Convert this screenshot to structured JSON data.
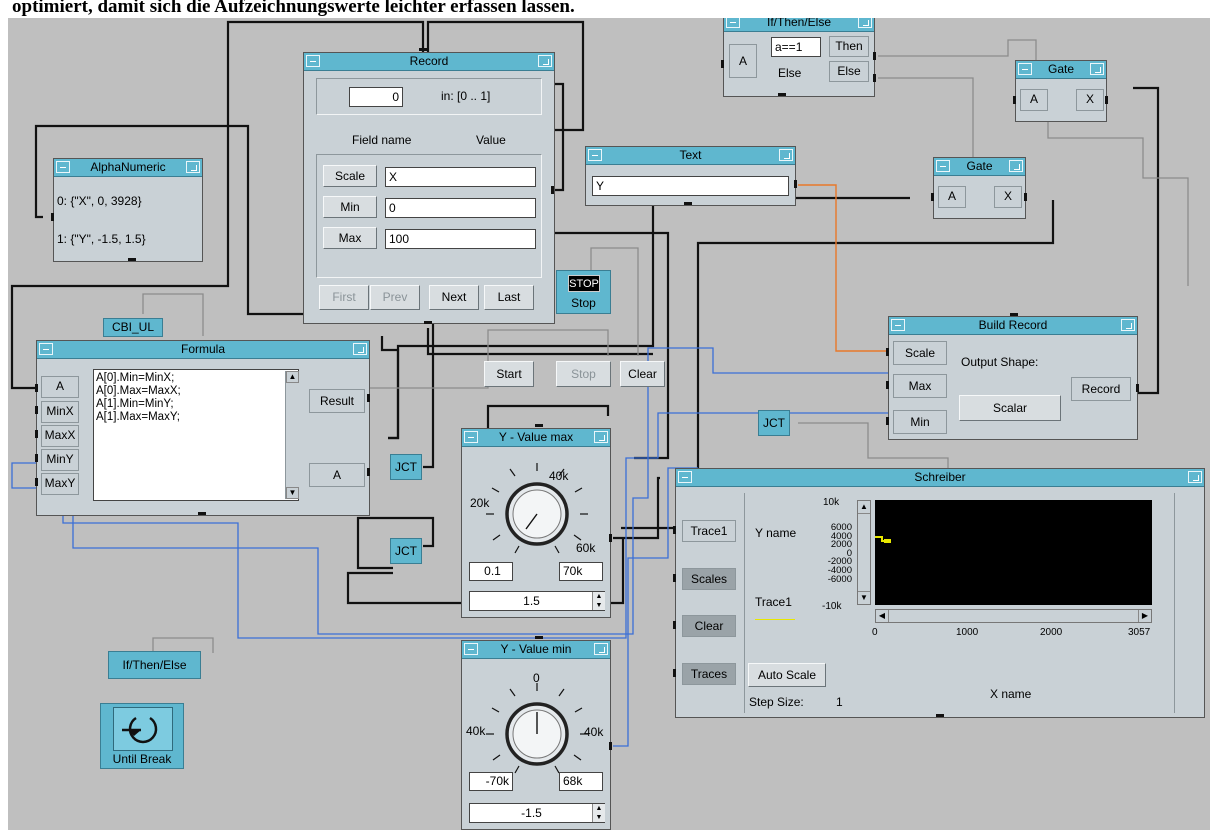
{
  "heading": "optimiert, damit sich die Aufzeichnungswerte leichter erfassen lassen.",
  "record": {
    "title": "Record",
    "index_value": "0",
    "range": "in: [0 .. 1]",
    "field_name_header": "Field name",
    "value_header": "Value",
    "fields": [
      {
        "name": "Scale",
        "value": "X"
      },
      {
        "name": "Min",
        "value": "0"
      },
      {
        "name": "Max",
        "value": "100"
      }
    ],
    "nav": [
      "First",
      "Prev",
      "Next",
      "Last"
    ]
  },
  "alphanumeric": {
    "title": "AlphaNumeric",
    "lines": [
      "0: {\"X\", 0, 3928}",
      "1: {\"Y\", -1.5, 1.5}"
    ]
  },
  "if_then_else_top": {
    "title": "If/Then/Else",
    "input": "A",
    "condition": "a==1",
    "else_label": "Else",
    "outputs": [
      "Then",
      "Else"
    ]
  },
  "gate_top": {
    "title": "Gate",
    "input": "A",
    "output": "X"
  },
  "gate_mid": {
    "title": "Gate",
    "input": "A",
    "output": "X"
  },
  "text_box": {
    "title": "Text",
    "value": "Y"
  },
  "stop_button": {
    "icon_text": "STOP",
    "label": "Stop"
  },
  "cbi_ul": "CBI_UL",
  "formula": {
    "title": "Formula",
    "inputs": [
      "A",
      "MinX",
      "MaxX",
      "MinY",
      "MaxY"
    ],
    "lines": [
      "A[0].Min=MinX;",
      "A[0].Max=MaxX;",
      "A[1].Min=MinY;",
      "A[1].Max=MaxY;"
    ],
    "outputs": [
      "Result",
      "A"
    ]
  },
  "buttons": {
    "start": "Start",
    "stop": "Stop",
    "clear": "Clear"
  },
  "build_record": {
    "title": "Build Record",
    "inputs": [
      "Scale",
      "Max",
      "Min"
    ],
    "output_shape_label": "Output Shape:",
    "shape_value": "Scalar",
    "output": "Record"
  },
  "jct_label": "JCT",
  "y_max": {
    "title": "Y - Value max",
    "dial_labels": [
      "20k",
      "40k",
      "60k"
    ],
    "min": "0.1",
    "max": "70k",
    "value": "1.5"
  },
  "y_min": {
    "title": "Y - Value min",
    "dial_labels": [
      "0",
      "40k",
      "40k"
    ],
    "min": "-70k",
    "max": "68k",
    "value": "-1.5"
  },
  "schreiber": {
    "title": "Schreiber",
    "inputs": [
      "Trace1",
      "Scales",
      "Clear",
      "Traces"
    ],
    "y_name": "Y name",
    "trace_name": "Trace1",
    "y_ticks": [
      "10k",
      "6000",
      "4000",
      "2000",
      "0",
      "-2000",
      "-4000",
      "-6000",
      "-10k"
    ],
    "x_ticks": [
      "0",
      "1000",
      "2000",
      "3057"
    ],
    "auto_scale": "Auto Scale",
    "step_size_label": "Step Size:",
    "step_size_value": "1",
    "x_name": "X name",
    "trace_color": "#e8e800"
  },
  "if_then_else_icon": "If/Then/Else",
  "until_break": "Until Break",
  "colors": {
    "title_bar": "#5fb7cf",
    "canvas": "#bfbfbf",
    "panel": "#c9d1d6",
    "wire_blue": "#3b6fd6",
    "wire_orange": "#e8782a"
  }
}
